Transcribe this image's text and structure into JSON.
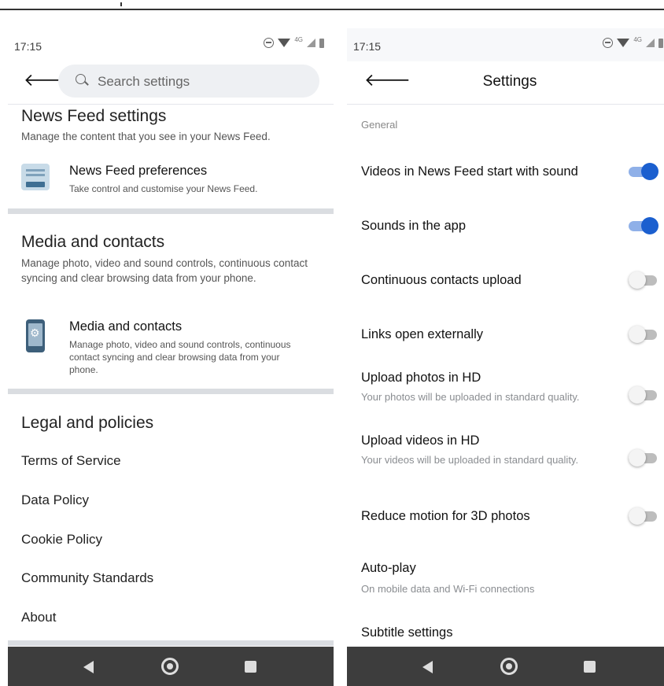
{
  "status_bar": {
    "time": "17:15",
    "network": "4G"
  },
  "left": {
    "search": {
      "placeholder": "Search settings"
    },
    "news_feed": {
      "title": "News Feed settings",
      "description": "Manage the content that you see in your News Feed.",
      "entry_title": "News Feed preferences",
      "entry_desc": "Take control and customise your News Feed.",
      "entry_icon": "news-feed-icon"
    },
    "media": {
      "title": "Media and contacts",
      "description": "Manage photo, video and sound controls, continuous contact syncing and clear browsing data from your phone.",
      "entry_title": "Media and contacts",
      "entry_desc": "Manage photo, video and sound controls, continuous contact syncing and clear browsing data from your phone.",
      "entry_icon": "phone-settings-icon"
    },
    "legal": {
      "title": "Legal and policies",
      "items": [
        "Terms of Service",
        "Data Policy",
        "Cookie Policy",
        "Community Standards",
        "About"
      ]
    }
  },
  "right": {
    "title": "Settings",
    "group": "General",
    "settings": [
      {
        "label": "Videos in News Feed start with sound",
        "on": true
      },
      {
        "label": "Sounds in the app",
        "on": true
      },
      {
        "label": "Continuous contacts upload",
        "on": false
      },
      {
        "label": "Links open externally",
        "on": false
      },
      {
        "label": "Upload photos in HD",
        "sub": "Your photos will be uploaded in standard quality.",
        "on": false
      },
      {
        "label": "Upload videos in HD",
        "sub": "Your videos will be uploaded in standard quality.",
        "on": false
      },
      {
        "label": "Reduce motion for 3D photos",
        "on": false
      }
    ],
    "autoplay": {
      "label": "Auto-play",
      "sub": "On mobile data and Wi-Fi connections"
    },
    "subtitle_settings": "Subtitle settings"
  },
  "colors": {
    "toggle_on": "#1b5fcf",
    "toggle_track_on": "#8fb0e8",
    "toggle_off": "#bdbdbd",
    "nav_bar": "#3d3d3d"
  }
}
